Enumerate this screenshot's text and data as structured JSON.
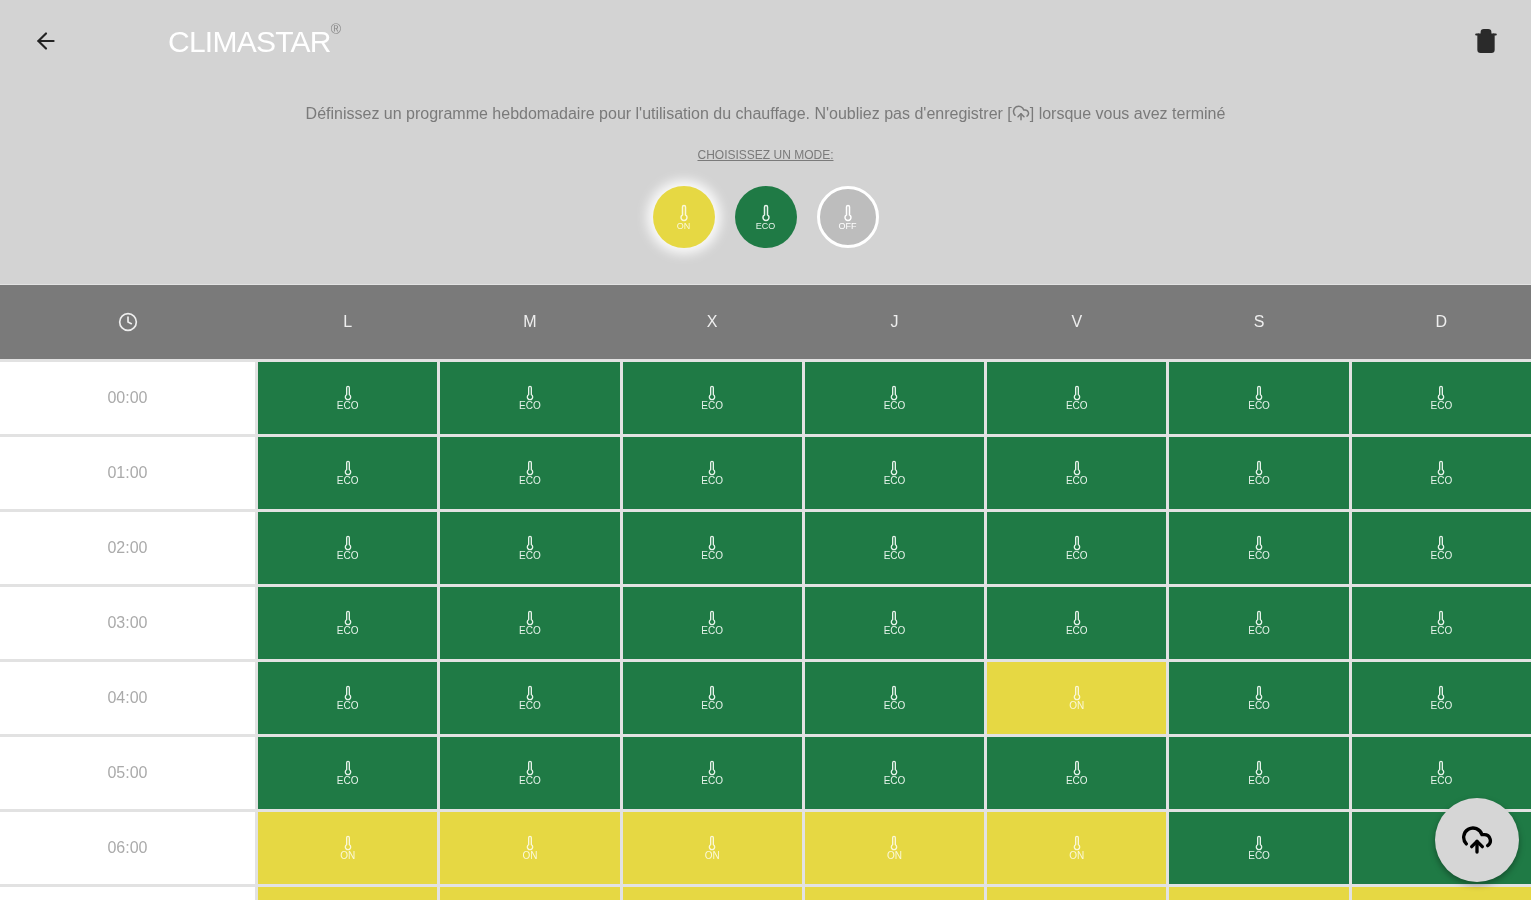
{
  "app_bar": {
    "title": "CLIMASTAR",
    "title_mark": "®"
  },
  "description": {
    "before_icon": "Définissez un programme hebdomadaire pour l'utilisation du chauffage. N'oubliez pas d'enregistrer [",
    "after_icon": "] lorsque vous avez terminé"
  },
  "mode_prompt": "CHOISISSEZ UN MODE:",
  "modes": [
    {
      "kind": "on",
      "label": "ON",
      "selected": true
    },
    {
      "kind": "eco",
      "label": "ECO",
      "selected": false
    },
    {
      "kind": "off",
      "label": "OFF",
      "selected": false
    }
  ],
  "table": {
    "columns": [
      "L",
      "M",
      "X",
      "J",
      "V",
      "S",
      "D"
    ],
    "rows": [
      {
        "time": "00:00",
        "cells": [
          {
            "kind": "eco",
            "label": "ECO"
          },
          {
            "kind": "eco",
            "label": "ECO"
          },
          {
            "kind": "eco",
            "label": "ECO"
          },
          {
            "kind": "eco",
            "label": "ECO"
          },
          {
            "kind": "eco",
            "label": "ECO"
          },
          {
            "kind": "eco",
            "label": "ECO"
          },
          {
            "kind": "eco",
            "label": "ECO"
          }
        ]
      },
      {
        "time": "01:00",
        "cells": [
          {
            "kind": "eco",
            "label": "ECO"
          },
          {
            "kind": "eco",
            "label": "ECO"
          },
          {
            "kind": "eco",
            "label": "ECO"
          },
          {
            "kind": "eco",
            "label": "ECO"
          },
          {
            "kind": "eco",
            "label": "ECO"
          },
          {
            "kind": "eco",
            "label": "ECO"
          },
          {
            "kind": "eco",
            "label": "ECO"
          }
        ]
      },
      {
        "time": "02:00",
        "cells": [
          {
            "kind": "eco",
            "label": "ECO"
          },
          {
            "kind": "eco",
            "label": "ECO"
          },
          {
            "kind": "eco",
            "label": "ECO"
          },
          {
            "kind": "eco",
            "label": "ECO"
          },
          {
            "kind": "eco",
            "label": "ECO"
          },
          {
            "kind": "eco",
            "label": "ECO"
          },
          {
            "kind": "eco",
            "label": "ECO"
          }
        ]
      },
      {
        "time": "03:00",
        "cells": [
          {
            "kind": "eco",
            "label": "ECO"
          },
          {
            "kind": "eco",
            "label": "ECO"
          },
          {
            "kind": "eco",
            "label": "ECO"
          },
          {
            "kind": "eco",
            "label": "ECO"
          },
          {
            "kind": "eco",
            "label": "ECO"
          },
          {
            "kind": "eco",
            "label": "ECO"
          },
          {
            "kind": "eco",
            "label": "ECO"
          }
        ]
      },
      {
        "time": "04:00",
        "cells": [
          {
            "kind": "eco",
            "label": "ECO"
          },
          {
            "kind": "eco",
            "label": "ECO"
          },
          {
            "kind": "eco",
            "label": "ECO"
          },
          {
            "kind": "eco",
            "label": "ECO"
          },
          {
            "kind": "on",
            "label": "ON"
          },
          {
            "kind": "eco",
            "label": "ECO"
          },
          {
            "kind": "eco",
            "label": "ECO"
          }
        ]
      },
      {
        "time": "05:00",
        "cells": [
          {
            "kind": "eco",
            "label": "ECO"
          },
          {
            "kind": "eco",
            "label": "ECO"
          },
          {
            "kind": "eco",
            "label": "ECO"
          },
          {
            "kind": "eco",
            "label": "ECO"
          },
          {
            "kind": "eco",
            "label": "ECO"
          },
          {
            "kind": "eco",
            "label": "ECO"
          },
          {
            "kind": "eco",
            "label": "ECO"
          }
        ]
      },
      {
        "time": "06:00",
        "cells": [
          {
            "kind": "on",
            "label": "ON"
          },
          {
            "kind": "on",
            "label": "ON"
          },
          {
            "kind": "on",
            "label": "ON"
          },
          {
            "kind": "on",
            "label": "ON"
          },
          {
            "kind": "on",
            "label": "ON"
          },
          {
            "kind": "eco",
            "label": "ECO"
          },
          {
            "kind": "eco"
          }
        ]
      },
      {
        "cells": [
          {
            "kind": "on"
          },
          {
            "kind": "on"
          },
          {
            "kind": "on"
          },
          {
            "kind": "on"
          },
          {
            "kind": "on"
          },
          {
            "kind": "on"
          },
          {
            "kind": "on"
          }
        ]
      }
    ]
  }
}
